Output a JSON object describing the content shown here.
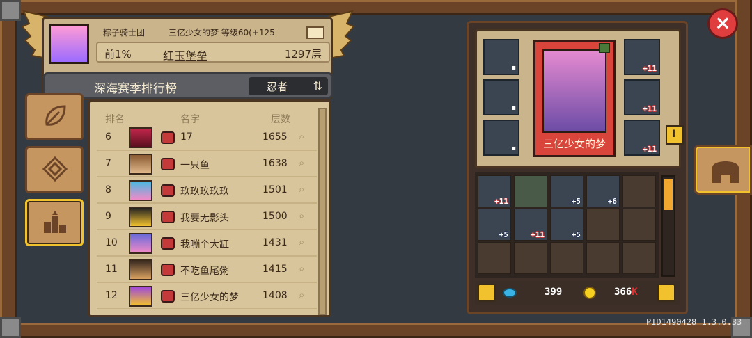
{
  "header": {
    "guild": "粽子骑士团",
    "player_line": "三亿少女的梦  等级60(+125",
    "rank_percent": "前1%",
    "fortress": "红玉堡垒",
    "floors": "1297层"
  },
  "season": {
    "title": "深海赛季排行榜",
    "class_label": "忍者"
  },
  "board": {
    "columns": [
      "排名",
      "名字",
      "层数"
    ],
    "rows": [
      {
        "rank": "6",
        "name": "17",
        "floors": "1655"
      },
      {
        "rank": "7",
        "name": "一只鱼",
        "floors": "1638"
      },
      {
        "rank": "8",
        "name": "玖玖玖玖玖",
        "floors": "1501"
      },
      {
        "rank": "9",
        "name": "我要无影头",
        "floors": "1500"
      },
      {
        "rank": "10",
        "name": "我嘣个大缸",
        "floors": "1431"
      },
      {
        "rank": "11",
        "name": "不吃鱼尾粥",
        "floors": "1415"
      },
      {
        "rank": "12",
        "name": "三亿少女的梦",
        "floors": "1408"
      }
    ]
  },
  "equip": {
    "hero_name": "三亿少女的梦",
    "tab_marker": "I",
    "slot_plus": [
      "+11",
      "+11",
      "+11"
    ],
    "inventory_plus": [
      "+11",
      "+5",
      "+6",
      "+5",
      "+11",
      "+5"
    ]
  },
  "currency": {
    "gems": "399",
    "coins": "366",
    "coins_suffix": "K"
  },
  "version": "PID1490428 1.3.0.33",
  "close_label": "×",
  "icons": {
    "swap": "swap-arrows-icon",
    "search": "magnifier-icon"
  }
}
